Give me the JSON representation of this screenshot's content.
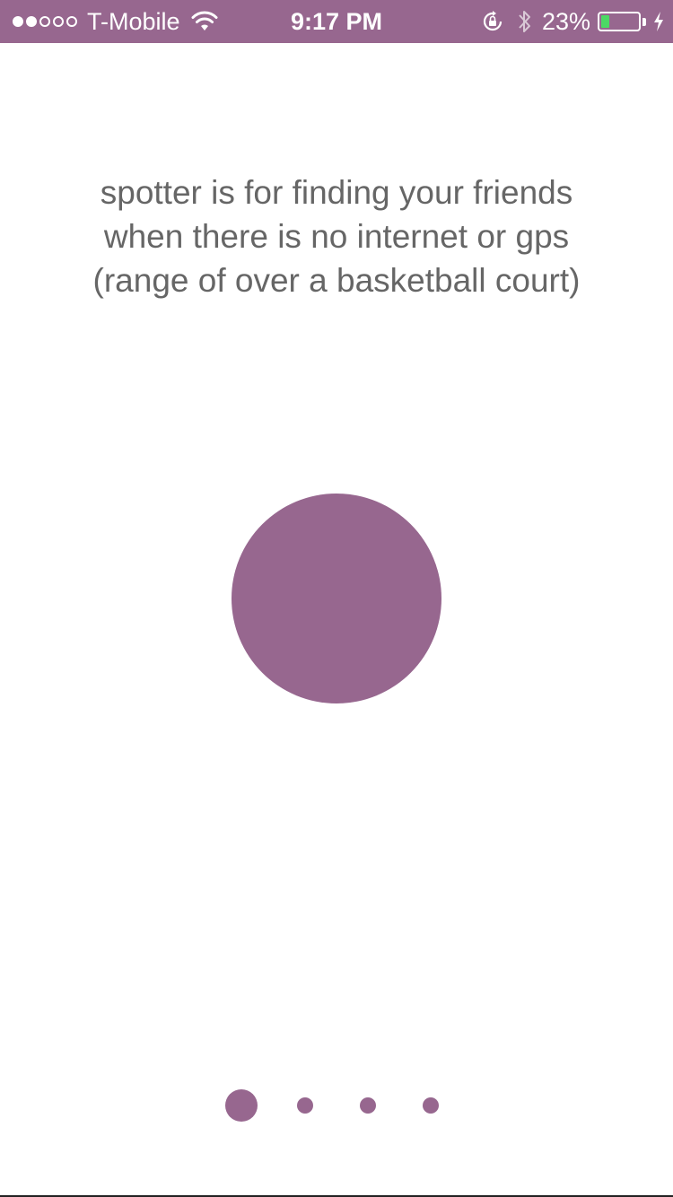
{
  "status_bar": {
    "carrier": "T-Mobile",
    "signal_bars_filled": 2,
    "signal_bars_total": 5,
    "time": "9:17 PM",
    "battery_percent": "23%",
    "battery_level": 0.23,
    "icons": [
      "wifi-icon",
      "rotation-lock-icon",
      "bluetooth-icon",
      "battery-icon",
      "charging-bolt-icon"
    ],
    "background_color": "#97678f"
  },
  "onboarding": {
    "lines": [
      "spotter is for finding your friends",
      "when there is no internet or gps",
      "(range of over a basketball court)"
    ],
    "accent_color": "#97678f",
    "text_color": "#666666"
  },
  "pager": {
    "total_pages": 4,
    "current_page": 1
  }
}
